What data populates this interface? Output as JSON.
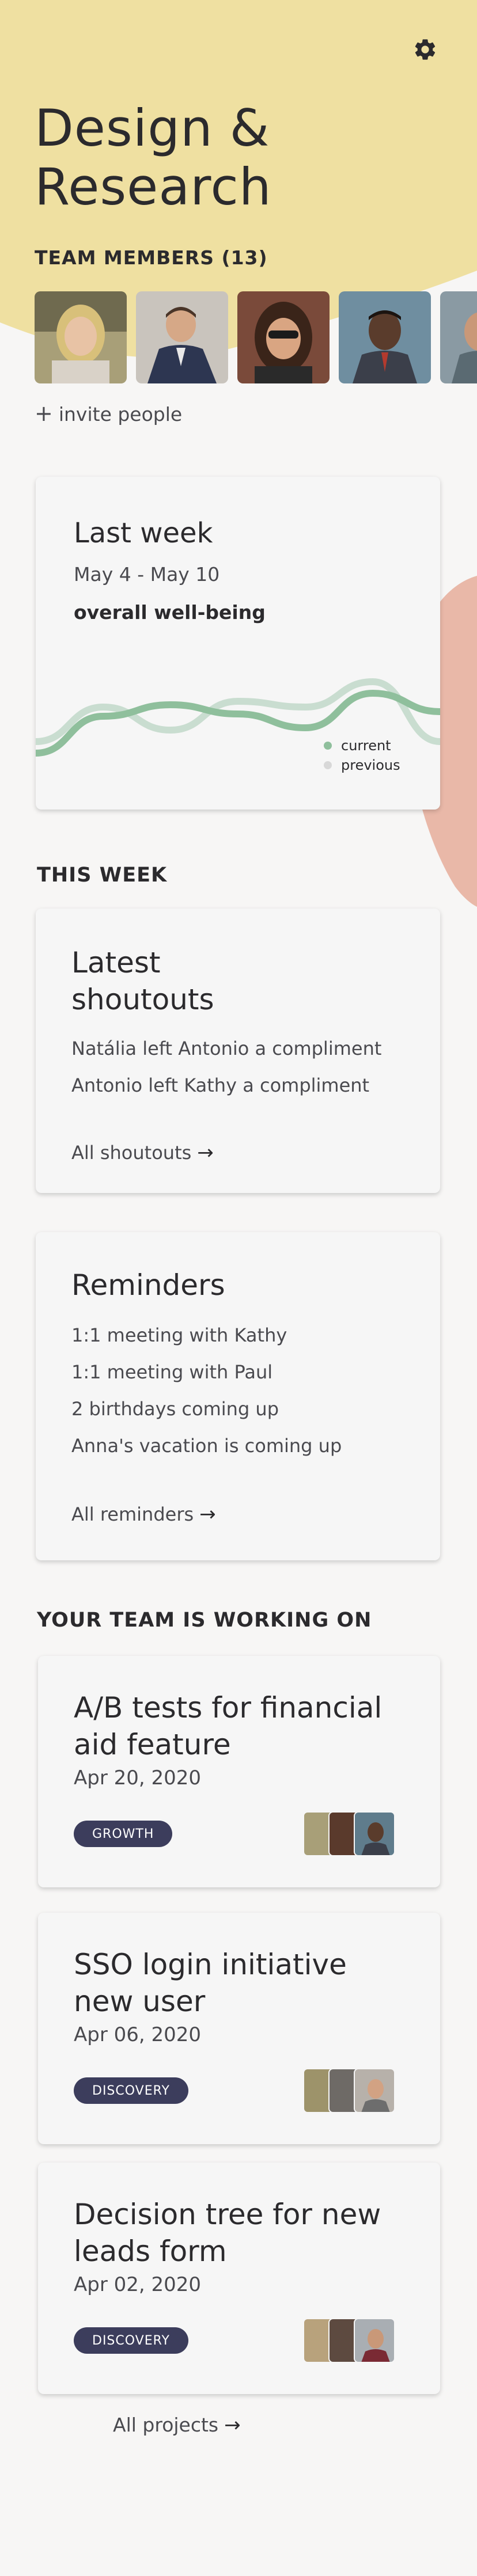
{
  "header": {
    "title_line1": "Design &",
    "title_line2": "Research",
    "settings_icon": "gear-icon"
  },
  "team": {
    "label": "TEAM MEMBERS (13)",
    "invite_label": "invite people",
    "invite_icon": "plus-icon"
  },
  "last_week": {
    "title": "Last week",
    "dates": "May 4 - May 10",
    "metric": "overall well-being",
    "legend_current": "current",
    "legend_previous": "previous",
    "chart_data": {
      "type": "line",
      "series": [
        {
          "name": "current",
          "values": [
            10,
            42,
            52,
            44,
            32,
            62,
            46
          ],
          "color": "#8fbf9c"
        },
        {
          "name": "previous",
          "values": [
            20,
            50,
            30,
            55,
            50,
            72,
            20
          ],
          "color": "#c9ddd0"
        }
      ],
      "x": [
        0,
        1,
        2,
        3,
        4,
        5,
        6
      ],
      "xlabel": "",
      "ylabel": "",
      "grid": false,
      "legend": "bottom-right"
    }
  },
  "this_week": {
    "label": "THIS WEEK",
    "shoutouts": {
      "heading_line1": "Latest",
      "heading_line2": "shoutouts",
      "items": [
        "Natália left Antonio a compliment",
        "Antonio left Kathy a compliment"
      ],
      "link": "All shoutouts"
    },
    "reminders": {
      "heading": "Reminders",
      "items": [
        "1:1 meeting with Kathy",
        "1:1 meeting with Paul",
        "2 birthdays coming up",
        "Anna's vacation is coming up"
      ],
      "link": "All reminders"
    }
  },
  "projects": {
    "label": "YOUR TEAM IS WORKING ON",
    "items": [
      {
        "title": "A/B tests for financial aid feature",
        "date": "Apr 20, 2020",
        "tag": "GROWTH"
      },
      {
        "title": "SSO login initiative new user",
        "date": "Apr 06, 2020",
        "tag": "DISCOVERY"
      },
      {
        "title": "Decision tree for new leads form",
        "date": "Apr 02, 2020",
        "tag": "DISCOVERY"
      }
    ],
    "all_link": "All projects"
  },
  "colors": {
    "yellow": "#efe0a1",
    "pink": "#e9b8a8",
    "badge": "#3c3d5c",
    "current": "#8fbf9c",
    "previous": "#c9ddd0"
  }
}
